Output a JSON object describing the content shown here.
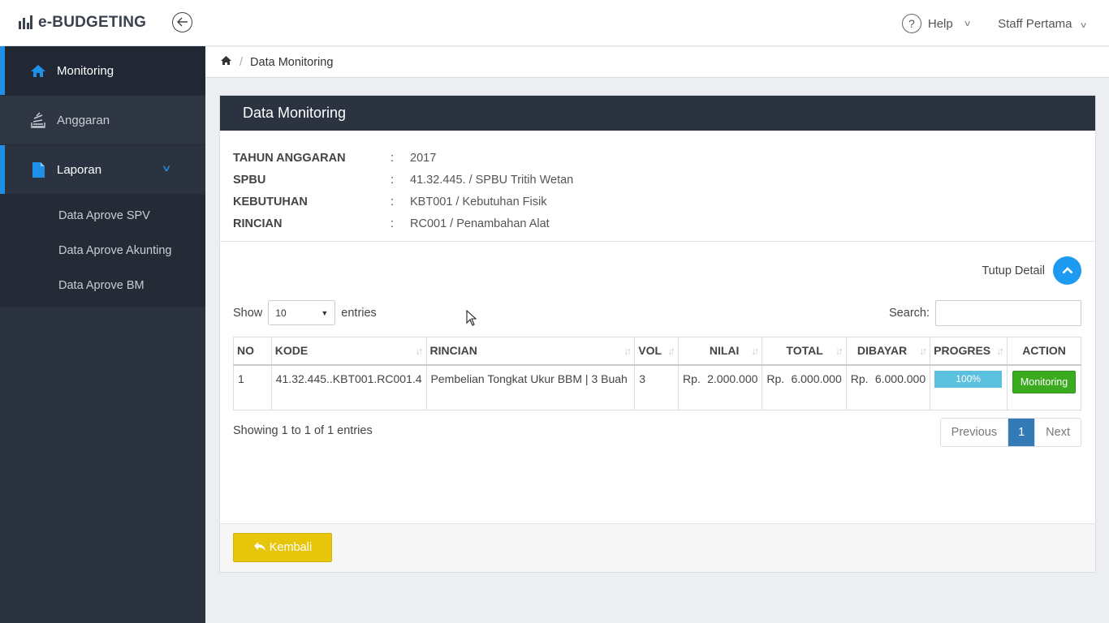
{
  "app": {
    "brand": "e-BUDGETING"
  },
  "topbar": {
    "help_label": "Help",
    "user_label": "Staff Pertama"
  },
  "sidebar": {
    "items": [
      {
        "label": "Monitoring",
        "icon": "home-icon"
      },
      {
        "label": "Anggaran",
        "icon": "stack-icon"
      },
      {
        "label": "Laporan",
        "icon": "file-icon"
      }
    ],
    "submenu": [
      "Data Aprove SPV",
      "Data Aprove Akunting",
      "Data Aprove BM"
    ]
  },
  "breadcrumb": {
    "current": "Data Monitoring"
  },
  "card": {
    "title": "Data Monitoring",
    "info": [
      {
        "label": "TAHUN ANGGARAN",
        "colon": ":",
        "value": "2017"
      },
      {
        "label": "SPBU",
        "colon": ":",
        "value": "41.32.445. / SPBU Tritih Wetan"
      },
      {
        "label": "KEBUTUHAN",
        "colon": ":",
        "value": "KBT001 / Kebutuhan Fisik"
      },
      {
        "label": "RINCIAN",
        "colon": ":",
        "value": "RC001 / Penambahan Alat"
      }
    ],
    "toggle_label": "Tutup Detail"
  },
  "table_controls": {
    "show_label": "Show",
    "entries_value": "10",
    "entries_label": "entries",
    "search_label": "Search:",
    "search_value": ""
  },
  "table": {
    "headers": [
      "NO",
      "KODE",
      "RINCIAN",
      "VOL",
      "NILAI",
      "TOTAL",
      "DIBAYAR",
      "PROGRES",
      "ACTION"
    ],
    "rows": [
      {
        "no": "1",
        "kode": "41.32.445..KBT001.RC001.4",
        "rincian": "Pembelian Tongkat Ukur BBM | 3 Buah",
        "vol": "3",
        "nilai_cur": "Rp.",
        "nilai": "2.000.000",
        "total_cur": "Rp.",
        "total": "6.000.000",
        "dibayar_cur": "Rp.",
        "dibayar": "6.000.000",
        "progres": "100%",
        "progress_fraction": 1.0,
        "action": "Monitoring"
      }
    ]
  },
  "pagination": {
    "info": "Showing 1 to 1 of 1 entries",
    "previous": "Previous",
    "current": "1",
    "next": "Next"
  },
  "footer": {
    "back_label": "Kembali"
  },
  "colors": {
    "accent": "#1e90e8",
    "sidebar": "#2c3340",
    "success": "#3aaa1e",
    "warning": "#e6c50a",
    "progress": "#5bc0de",
    "page_active": "#337ab7"
  }
}
